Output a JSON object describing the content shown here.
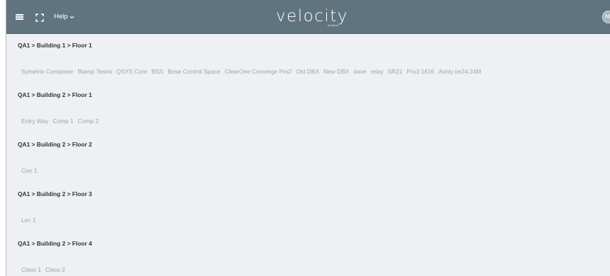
{
  "header": {
    "help_label": "Help",
    "brand_name": "velocity",
    "brand_sub": "by Atlona",
    "avatar_initials": "NM",
    "bar_color": "#60747f"
  },
  "sections": [
    {
      "title": "QA1 > Building 1 > Floor 1",
      "rooms": [
        "Symetrix Composer",
        "Biamp Tesira",
        "QSYS Core",
        "BSS",
        "Bose Control Space",
        "ClearOne Converge Pro2",
        "Old DBX",
        "New DBX",
        "dave",
        "relay",
        "SR21",
        "Pro3 1616",
        "Ashly ne24.24M"
      ]
    },
    {
      "title": "QA1 > Building 2 > Floor 1",
      "rooms": [
        "Entry Way",
        "Comp 1",
        "Comp 2"
      ]
    },
    {
      "title": "QA1 > Building 2 > Floor 2",
      "rooms": [
        "Con 1"
      ]
    },
    {
      "title": "QA1 > Building 2 > Floor 3",
      "rooms": [
        "Lec 1"
      ]
    },
    {
      "title": "QA1 > Building 2 > Floor 4",
      "rooms": [
        "Class 1",
        "Class 2"
      ]
    }
  ]
}
